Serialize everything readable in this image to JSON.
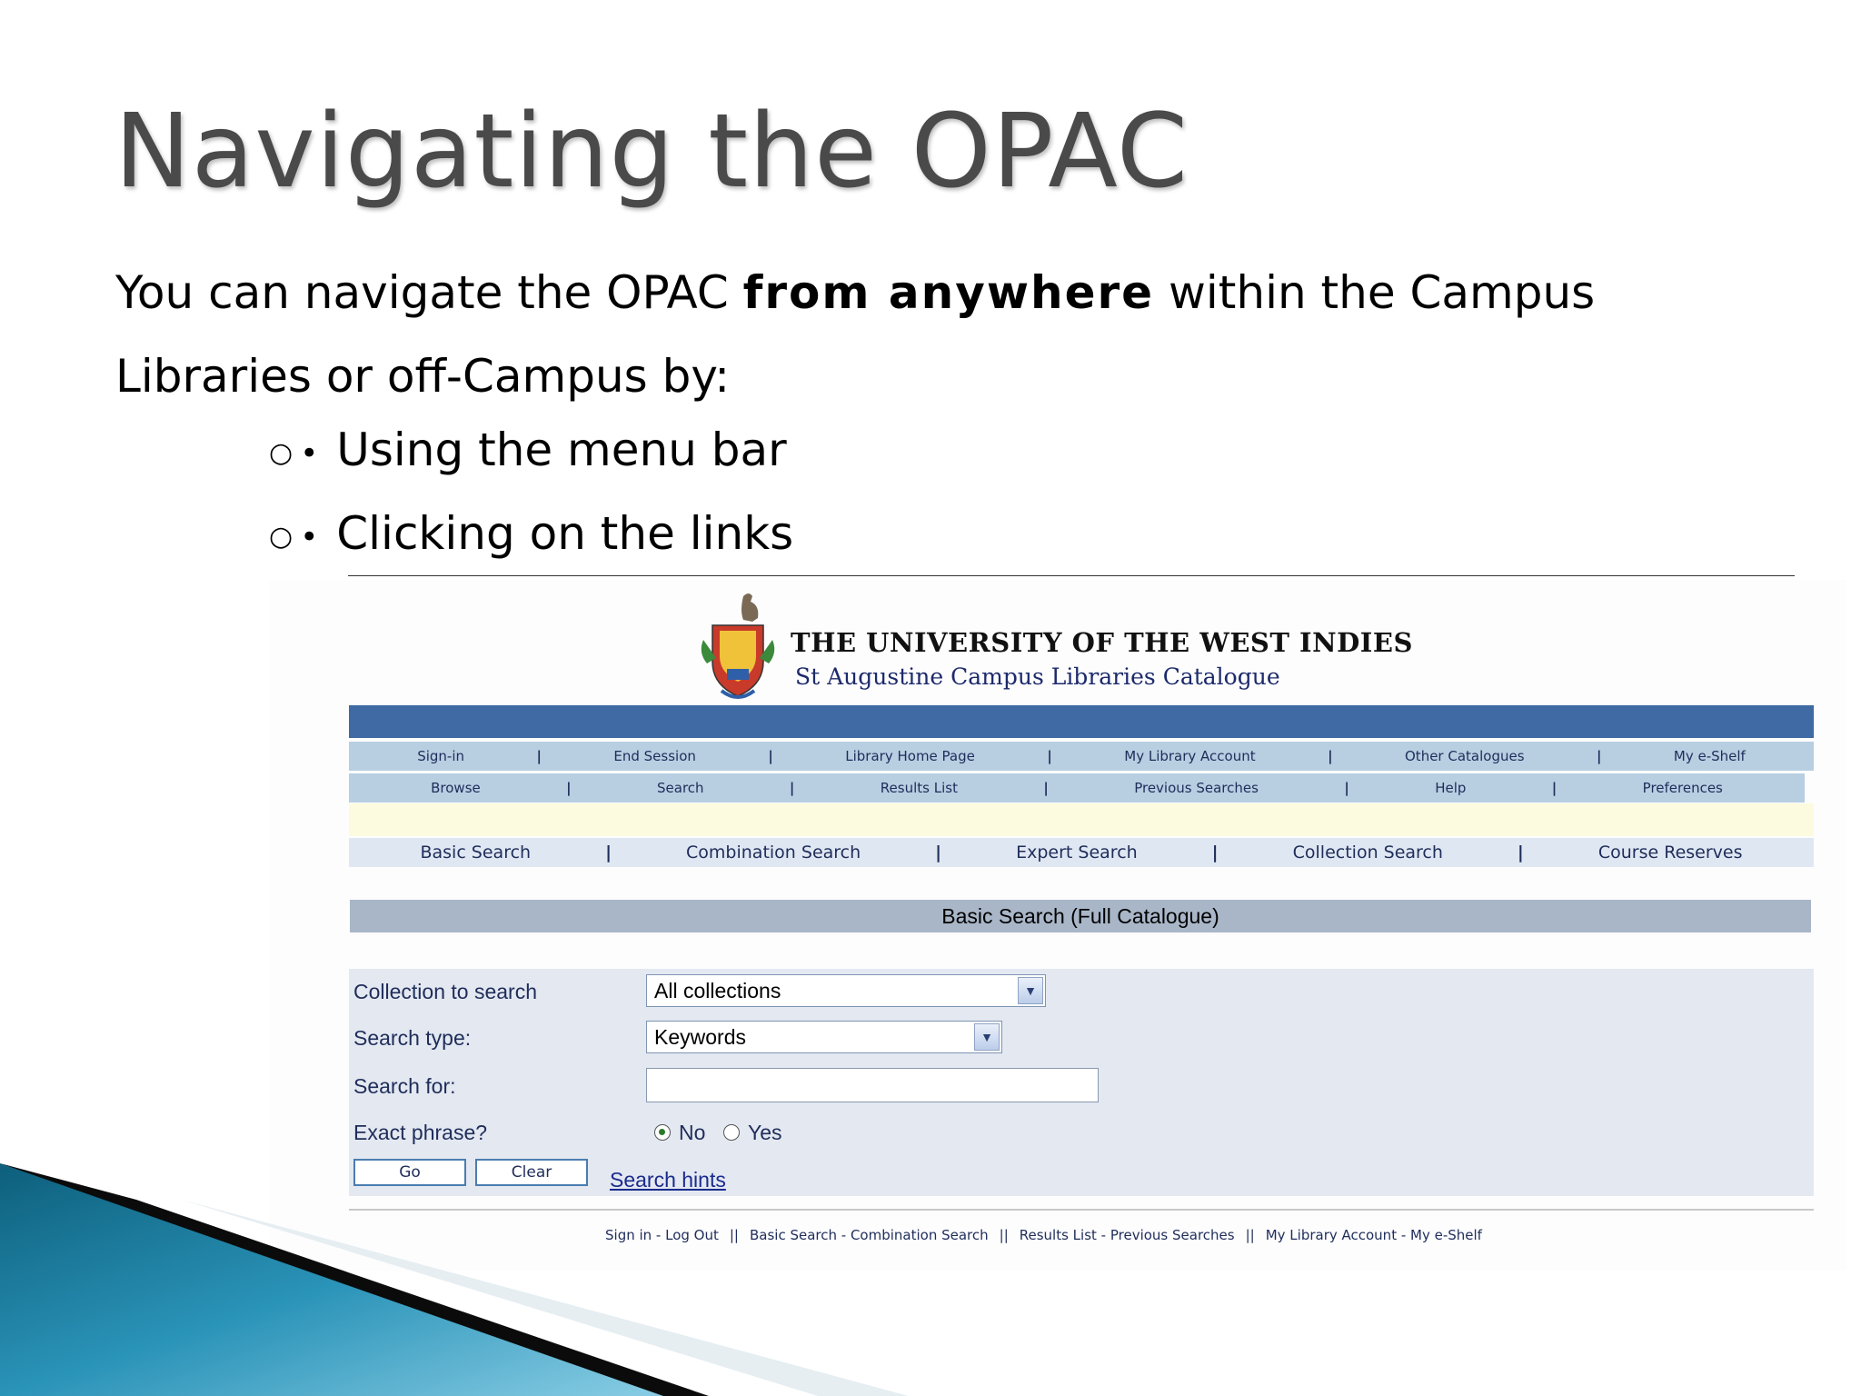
{
  "slide": {
    "title": "Navigating the OPAC",
    "intro_prefix": "You can navigate the OPAC ",
    "intro_bold": "from anywhere",
    "intro_suffix": "  within the Campus Libraries or off-Campus by:",
    "bullets": [
      "Using the menu bar",
      "Clicking on the links"
    ],
    "bullet_circle_glyph": "○",
    "bullet_dot_glyph": "•"
  },
  "opac": {
    "logo_icon": "uwi-crest-icon",
    "university": "THE UNIVERSITY OF THE WEST INDIES",
    "catalogue": "St Augustine Campus Libraries Catalogue",
    "nav_row1": [
      "Sign-in",
      "End Session",
      "Library Home Page",
      "My Library Account",
      "Other Catalogues",
      "My e-Shelf"
    ],
    "nav_row2": [
      "Browse",
      "Search",
      "Results List",
      "Previous Searches",
      "Help",
      "Preferences"
    ],
    "nav_separator": "|",
    "search_tabs": [
      "Basic Search",
      "Combination Search",
      "Expert Search",
      "Collection Search",
      "Course Reserves"
    ],
    "section_heading": "Basic Search (Full Catalogue)",
    "form": {
      "collection_label": "Collection to search",
      "collection_value": "All collections",
      "search_type_label": "Search type:",
      "search_type_value": "Keywords",
      "search_for_label": "Search for:",
      "search_for_value": "",
      "exact_label": "Exact phrase?",
      "exact_no": "No",
      "exact_yes": "Yes",
      "exact_selected": "No",
      "go_label": "Go",
      "clear_label": "Clear",
      "hints_label": "Search hints",
      "dropdown_icon": "chevron-down-icon"
    },
    "footer": {
      "link1": "Sign in - Log Out",
      "link2": "Basic Search - Combination Search",
      "link3": "Results List - Previous Searches",
      "link4": "My Library Account - My e-Shelf",
      "separator": "||"
    }
  },
  "colors": {
    "title_gray": "#4a4a4a",
    "nav_blue": "#3f6aa3",
    "nav_row": "#b8cfe2",
    "link_navy": "#1f2d5a",
    "deco_teal": "#1f86a8"
  }
}
